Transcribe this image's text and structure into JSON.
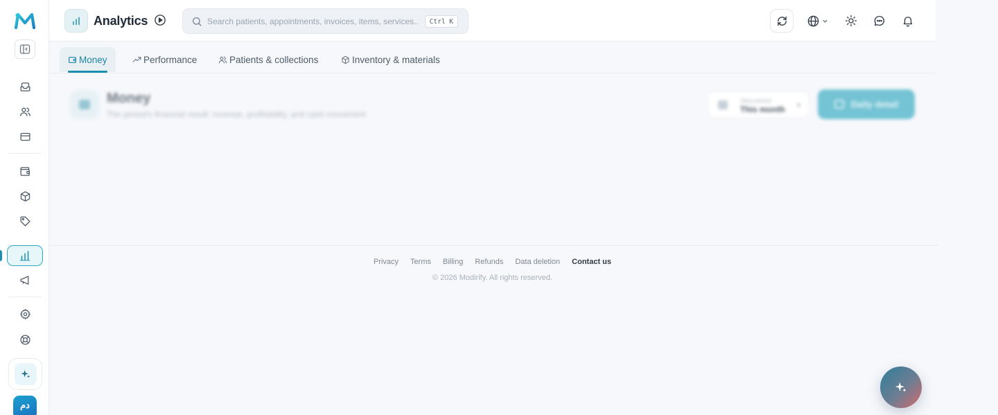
{
  "app": {
    "brand_color": "#1b8fb0",
    "logo_icon": "modirify-m-logo"
  },
  "sidebar": {
    "collapse_icon": "sidebar-collapse-icon",
    "items": [
      {
        "icon": "inbox-icon"
      },
      {
        "icon": "users-icon"
      },
      {
        "icon": "credit-card-icon"
      },
      {
        "icon": "wallet-icon"
      },
      {
        "icon": "package-icon"
      },
      {
        "icon": "tag-icon"
      },
      {
        "icon": "bar-chart-icon",
        "active": true
      },
      {
        "icon": "megaphone-icon"
      },
      {
        "icon": "gear-icon"
      },
      {
        "icon": "lifebuoy-icon"
      }
    ],
    "ai_icon": "sparkle-icon",
    "avatar_initials": "دم"
  },
  "header": {
    "title": "Analytics",
    "search": {
      "placeholder": "Search patients, appointments, invoices, items, services...",
      "shortcut": "Ctrl K"
    }
  },
  "tabs": [
    {
      "label": "Money",
      "icon": "wallet-icon",
      "active": true
    },
    {
      "label": "Performance",
      "icon": "trend-up-icon",
      "active": false
    },
    {
      "label": "Patients & collections",
      "icon": "users-icon",
      "active": false
    },
    {
      "label": "Inventory & materials",
      "icon": "box-icon",
      "active": false
    }
  ],
  "page_header": {
    "title": "Money",
    "subtitle": "The period's financial result: revenue, profitability, and cash movement",
    "period_label": "View period",
    "period_value": "This month",
    "daily_button": "Daily detail"
  },
  "footer": {
    "links": [
      "Privacy",
      "Terms",
      "Billing",
      "Refunds",
      "Data deletion"
    ],
    "contact": "Contact us",
    "copyright": "© 2026 Modirify. All rights reserved."
  }
}
